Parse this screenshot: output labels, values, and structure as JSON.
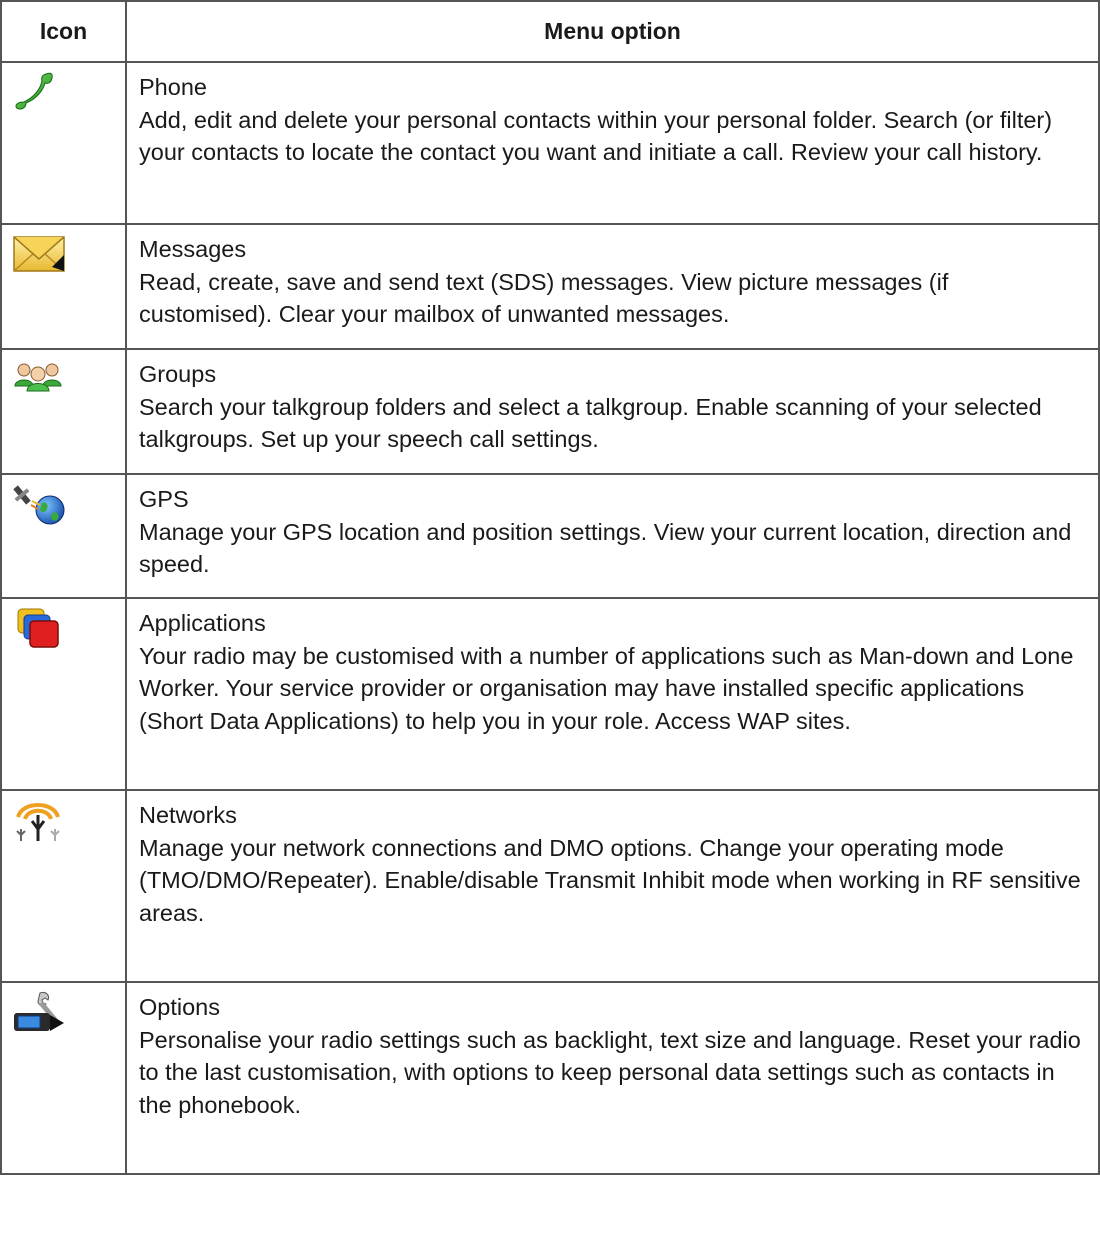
{
  "table": {
    "headers": {
      "icon": "Icon",
      "menu_option": "Menu option"
    },
    "rows": [
      {
        "icon": "phone-icon",
        "title": "Phone",
        "description": "Add, edit and delete your personal contacts within your personal folder. Search (or filter) your contacts to locate the contact you want and initiate a call. Review your call history."
      },
      {
        "icon": "envelope-icon",
        "title": "Messages",
        "description": "Read, create, save and send text (SDS) messages. View picture messages (if customised). Clear your mailbox of unwanted messages."
      },
      {
        "icon": "groups-icon",
        "title": "Groups",
        "description": "Search your talkgroup folders and select a talkgroup. Enable scanning of your selected talkgroups. Set up your speech call settings."
      },
      {
        "icon": "gps-satellite-globe-icon",
        "title": "GPS",
        "description": "Manage your GPS location and position settings. View your current location, direction and speed."
      },
      {
        "icon": "applications-icon",
        "title": "Applications",
        "description": "Your radio may be customised with a number of applications such as Man-down and Lone Worker. Your service provider or organisation may have installed specific applications (Short Data Applications) to help you in your role. Access WAP sites."
      },
      {
        "icon": "network-antenna-icon",
        "title": "Networks",
        "description": "Manage your network connections and DMO options. Change your operating mode (TMO/DMO/Repeater). Enable/disable Transmit Inhibit mode when working in RF sensitive areas."
      },
      {
        "icon": "options-wrench-radio-icon",
        "title": "Options",
        "description": "Personalise your radio settings such as backlight, text size and language. Reset your radio to the last customisation, with options to keep personal data settings such as contacts in the phonebook."
      }
    ]
  }
}
